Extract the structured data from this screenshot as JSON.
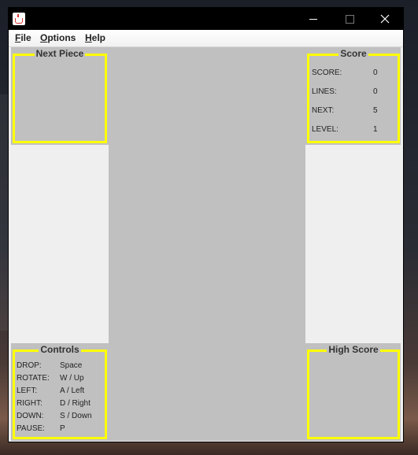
{
  "window": {
    "controls": {
      "minimize_icon": "minimize-icon",
      "maximize_icon": "maximize-icon",
      "close_icon": "close-icon"
    }
  },
  "menu": {
    "items": [
      "File",
      "Options",
      "Help"
    ]
  },
  "next_piece": {
    "title": "Next Piece"
  },
  "score": {
    "title": "Score",
    "rows": [
      {
        "label": "SCORE:",
        "value": "0"
      },
      {
        "label": "LINES:",
        "value": "0"
      },
      {
        "label": "NEXT:",
        "value": "5"
      },
      {
        "label": "LEVEL:",
        "value": "1"
      }
    ]
  },
  "controls": {
    "title": "Controls",
    "rows": [
      {
        "label": "DROP:",
        "value": "Space"
      },
      {
        "label": "ROTATE:",
        "value": "W / Up"
      },
      {
        "label": "LEFT:",
        "value": "A / Left"
      },
      {
        "label": "RIGHT:",
        "value": "D / Right"
      },
      {
        "label": "DOWN:",
        "value": "S / Down"
      },
      {
        "label": "PAUSE:",
        "value": "P"
      }
    ]
  },
  "high_score": {
    "title": "High Score"
  },
  "colors": {
    "frame": "#ffff00",
    "panel": "#c0c0c0",
    "background": "#efefef",
    "titlebar": "#000000"
  }
}
